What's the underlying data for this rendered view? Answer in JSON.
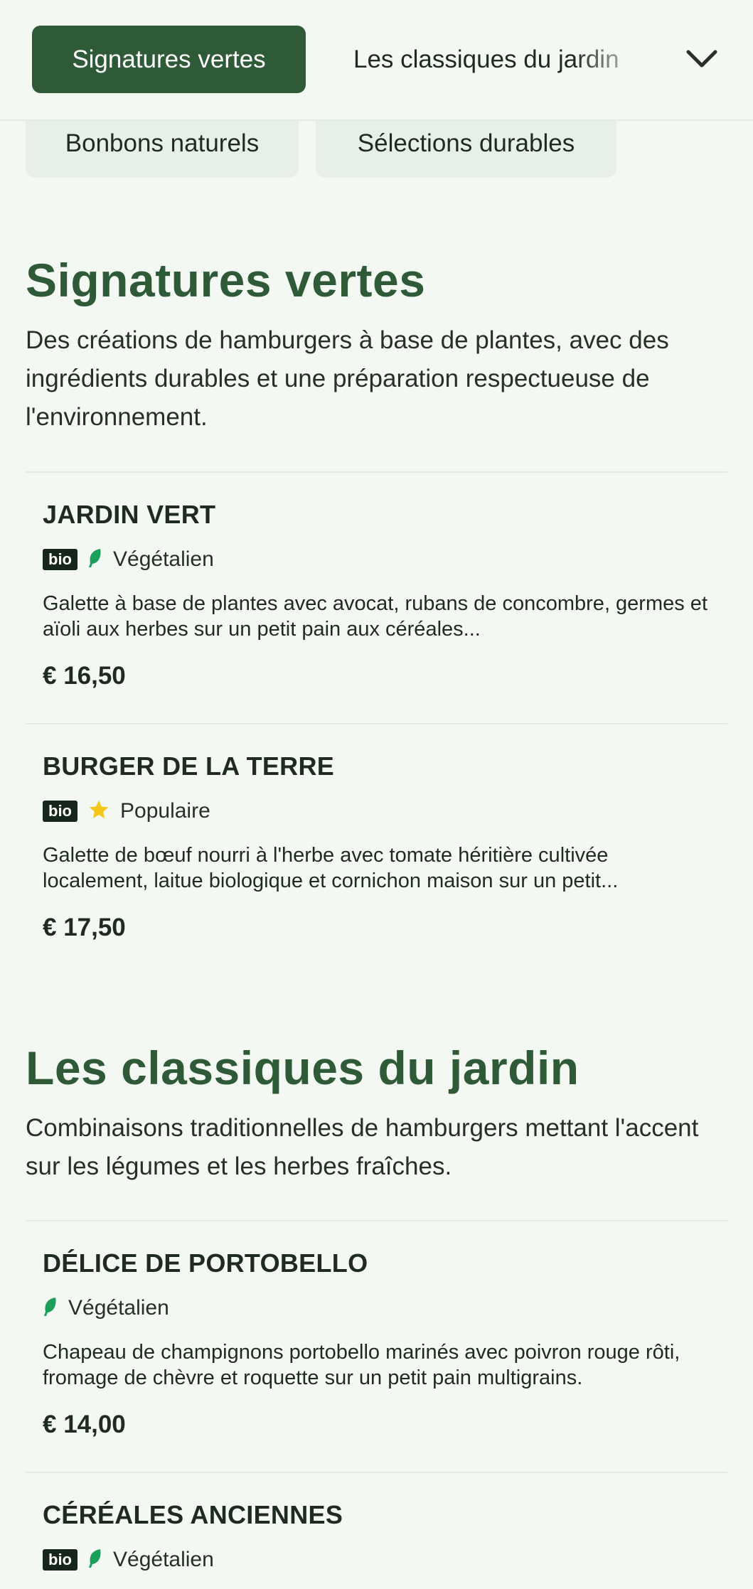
{
  "category_nav": {
    "active_tab": "Signatures vertes",
    "next_tab": "Les classiques du jardin",
    "chips": [
      "Bonbons naturels",
      "Sélections durables"
    ]
  },
  "sections": [
    {
      "title": "Signatures vertes",
      "description": "Des créations de hamburgers à base de plantes, avec des ingrédients durables et une préparation respectueuse de l'environnement.",
      "items": [
        {
          "name": "JARDIN VERT",
          "bio_badge": "bio",
          "tag": "Végétalien",
          "tag_icon": "leaf-icon",
          "description": "Galette à base de plantes avec avocat, rubans de concombre, germes et aïoli aux herbes sur un petit pain aux céréales...",
          "price": "€ 16,50"
        },
        {
          "name": "BURGER DE LA TERRE",
          "bio_badge": "bio",
          "tag": "Populaire",
          "tag_icon": "star-icon",
          "description": "Galette de bœuf nourri à l'herbe avec tomate héritière cultivée localement, laitue biologique et cornichon maison sur un petit...",
          "price": "€ 17,50"
        }
      ]
    },
    {
      "title": "Les classiques du jardin",
      "description": "Combinaisons traditionnelles de hamburgers mettant l'accent sur les légumes et les herbes fraîches.",
      "items": [
        {
          "name": "DÉLICE DE PORTOBELLO",
          "tag": "Végétalien",
          "tag_icon": "leaf-icon",
          "description": "Chapeau de champignons portobello marinés avec poivron rouge rôti, fromage de chèvre et roquette sur un petit pain multigrains.",
          "price": "€ 14,00"
        },
        {
          "name": "CÉRÉALES ANCIENNES",
          "bio_badge": "bio",
          "tag": "Végétalien",
          "tag_icon": "leaf-icon"
        }
      ]
    }
  ],
  "colors": {
    "brand_green": "#2f5a37",
    "leaf_green": "#1aa05a",
    "star_yellow": "#f5c518",
    "background": "#f4f8f3"
  }
}
